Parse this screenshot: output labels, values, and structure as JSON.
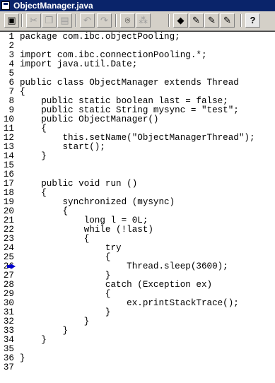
{
  "window": {
    "title": "ObjectManager.java"
  },
  "toolbar": {
    "buttons": [
      {
        "name": "save-button",
        "icon": "save-icon",
        "glyph": "▣",
        "disabled": false
      },
      {
        "name": "cut-button",
        "icon": "cut-icon",
        "glyph": "✂",
        "disabled": true
      },
      {
        "name": "copy-button",
        "icon": "copy-icon",
        "glyph": "❐",
        "disabled": true
      },
      {
        "name": "paste-button",
        "icon": "paste-icon",
        "glyph": "▤",
        "disabled": true
      },
      {
        "name": "undo-button",
        "icon": "undo-icon",
        "glyph": "↶",
        "disabled": true
      },
      {
        "name": "redo-button",
        "icon": "redo-icon",
        "glyph": "↷",
        "disabled": true
      },
      {
        "name": "find-button",
        "icon": "binoculars-icon",
        "glyph": "⌾",
        "disabled": false
      },
      {
        "name": "find-next-button",
        "icon": "find-next-icon",
        "glyph": "⁂",
        "disabled": true
      },
      {
        "name": "set-breakpoint-button",
        "icon": "breakpoint-icon",
        "glyph": "◆",
        "disabled": false
      },
      {
        "name": "toggle-breakpoint-button",
        "icon": "toggle-breakpoint-icon",
        "glyph": "✎",
        "disabled": false
      },
      {
        "name": "clear-breakpoint-button",
        "icon": "clear-breakpoint-icon",
        "glyph": "✎",
        "disabled": false
      },
      {
        "name": "clear-all-breakpoints-button",
        "icon": "clear-all-breakpoints-icon",
        "glyph": "✎",
        "disabled": false
      },
      {
        "name": "help-button",
        "icon": "help-icon",
        "glyph": "?",
        "disabled": false
      }
    ]
  },
  "editor": {
    "breakpoint_line": 26,
    "breakpoint_color": "#0000cc",
    "lines": [
      {
        "n": "1",
        "text": "package com.ibc.objectPooling;"
      },
      {
        "n": "2",
        "text": ""
      },
      {
        "n": "3",
        "text": "import com.ibc.connectionPooling.*;"
      },
      {
        "n": "4",
        "text": "import java.util.Date;"
      },
      {
        "n": "5",
        "text": ""
      },
      {
        "n": "6",
        "text": "public class ObjectManager extends Thread"
      },
      {
        "n": "7",
        "text": "{"
      },
      {
        "n": "8",
        "text": "    public static boolean last = false;"
      },
      {
        "n": "9",
        "text": "    public static String mysync = \"test\";"
      },
      {
        "n": "10",
        "text": "    public ObjectManager()"
      },
      {
        "n": "11",
        "text": "    {"
      },
      {
        "n": "12",
        "text": "        this.setName(\"ObjectManagerThread\");"
      },
      {
        "n": "13",
        "text": "        start();"
      },
      {
        "n": "14",
        "text": "    }"
      },
      {
        "n": "15",
        "text": ""
      },
      {
        "n": "16",
        "text": ""
      },
      {
        "n": "17",
        "text": "    public void run ()"
      },
      {
        "n": "18",
        "text": "    {"
      },
      {
        "n": "19",
        "text": "        synchronized (mysync)"
      },
      {
        "n": "20",
        "text": "        {"
      },
      {
        "n": "21",
        "text": "            long l = 0L;"
      },
      {
        "n": "22",
        "text": "            while (!last)"
      },
      {
        "n": "23",
        "text": "            {"
      },
      {
        "n": "24",
        "text": "                try"
      },
      {
        "n": "25",
        "text": "                {"
      },
      {
        "n": "26",
        "text": "                    Thread.sleep(3600);"
      },
      {
        "n": "27",
        "text": "                }"
      },
      {
        "n": "28",
        "text": "                catch (Exception ex)"
      },
      {
        "n": "29",
        "text": "                {"
      },
      {
        "n": "30",
        "text": "                    ex.printStackTrace();"
      },
      {
        "n": "31",
        "text": "                }"
      },
      {
        "n": "32",
        "text": "            }"
      },
      {
        "n": "33",
        "text": "        }"
      },
      {
        "n": "34",
        "text": "    }"
      },
      {
        "n": "35",
        "text": ""
      },
      {
        "n": "36",
        "text": "}"
      },
      {
        "n": "37",
        "text": ""
      }
    ]
  }
}
